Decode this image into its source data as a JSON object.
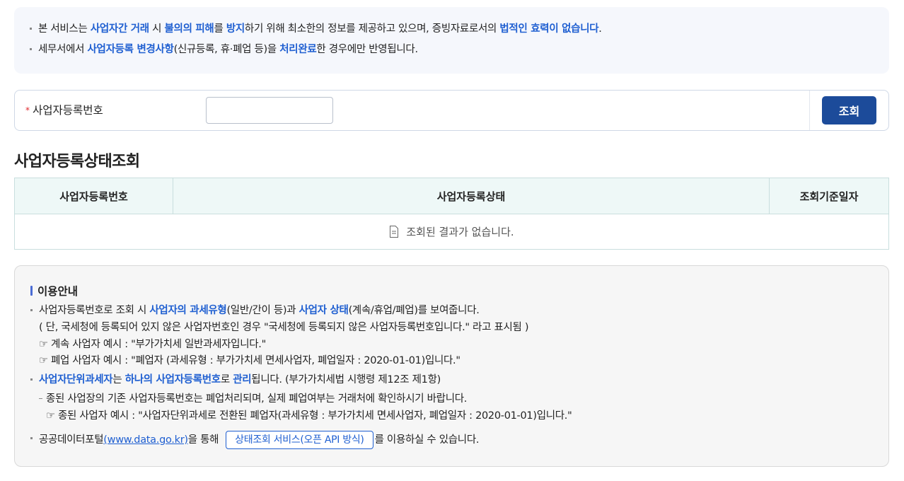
{
  "notice": {
    "line1": [
      "본 서비스는 ",
      "사업자간 거래",
      " 시 ",
      "불의의 피해",
      "를 ",
      "방지",
      "하기 위해 최소한의 정보를 제공하고 있으며, 증빙자료로서의 ",
      "법적인 효력이 없습니다",
      "."
    ],
    "line2": [
      "세무서에서 ",
      "사업자등록 변경사항",
      "(신규등록, 휴·폐업 등)을 ",
      "처리완료",
      "한 경우에만 반영됩니다."
    ]
  },
  "search": {
    "required_mark": "*",
    "label": "사업자등록번호",
    "value": "",
    "button_label": "조회"
  },
  "result": {
    "title": "사업자등록상태조회",
    "columns": [
      "사업자등록번호",
      "사업자등록상태",
      "조회기준일자"
    ],
    "empty_message": "조회된 결과가 없습니다."
  },
  "guide": {
    "title": "이용안내",
    "b1": [
      "사업자등록번호로 조회 시 ",
      "사업자의 과세유형",
      "(일반/간이 등)과 ",
      "사업자 상태",
      "(계속/휴업/폐업)를 보여줍니다."
    ],
    "b1_note": "( 단, 국세청에 등록되어 있지 않은 사업자번호인 경우 \"국세청에 등록되지 않은 사업자등록번호입니다.\" 라고 표시됨 )",
    "b1_ex1": "☞ 계속 사업자 예시 : \"부가가치세 일반과세자입니다.\"",
    "b1_ex2": "☞ 폐업 사업자 예시 : \"폐업자 (과세유형 : 부가가치세 면세사업자, 폐업일자 : 2020-01-01)입니다.\"",
    "b2": [
      "사업자단위과세자",
      "는 ",
      "하나의 사업자등록번호",
      "로 ",
      "관리",
      "됩니다. (부가가치세법 시행령 제12조 제1항)"
    ],
    "b2_sub": "종된 사업장의 기존 사업자등록번호는 폐업처리되며, 실제 폐업여부는 거래처에 확인하시기 바랍니다.",
    "b2_ex": "☞ 종된 사업자 예시 : \"사업자단위과세로 전환된 폐업자(과세유형 : 부가가치세 면세사업자, 폐업일자 : 2020-01-01)입니다.\"",
    "b3_pre": "공공데이터포털",
    "b3_link": "(www.data.go.kr)",
    "b3_mid": "을 통해",
    "b3_button": "상태조회 서비스(오픈 API 방식)",
    "b3_post": "를 이용하실 수 있습니다."
  }
}
